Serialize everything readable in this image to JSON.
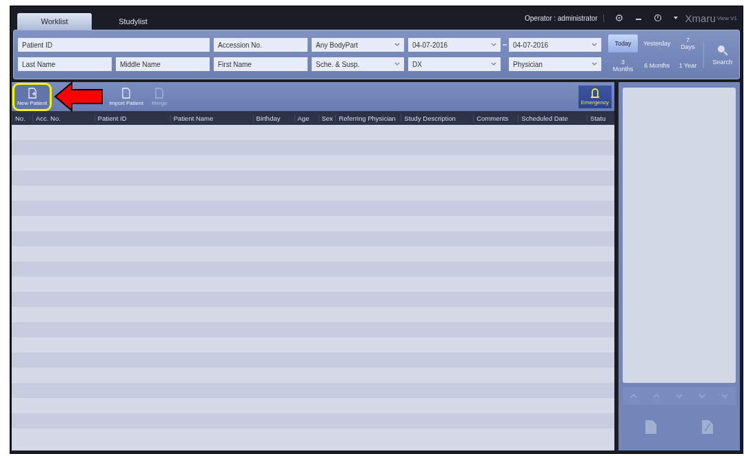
{
  "tabs": [
    {
      "label": "Worklist",
      "selected": true
    },
    {
      "label": "Studylist",
      "selected": false
    }
  ],
  "header": {
    "operator": "Operator : administrator",
    "logo": "Xmaru",
    "logo_suffix": "View V1"
  },
  "filters": {
    "row_1": [
      {
        "kind": "text",
        "placeholder": "Patient ID"
      },
      {
        "kind": "text",
        "placeholder": "Accession No."
      },
      {
        "kind": "select",
        "value": "Any BodyPart"
      },
      {
        "kind": "select",
        "value": "04-07-2016"
      },
      {
        "kind": "dash"
      },
      {
        "kind": "select",
        "value": "04-07-2016"
      }
    ],
    "row_2": [
      {
        "kind": "text",
        "placeholder": "Last Name"
      },
      {
        "kind": "text",
        "placeholder": "Middle Name"
      },
      {
        "kind": "text",
        "placeholder": "First Name"
      },
      {
        "kind": "select",
        "value": "Sche. & Susp."
      },
      {
        "kind": "select",
        "value": "DX"
      },
      {
        "kind": "select",
        "value": "Physician"
      }
    ],
    "ranges": [
      {
        "label": "Today",
        "selected": true
      },
      {
        "label": "Yesterday",
        "selected": false
      },
      {
        "label": "7 Days",
        "selected": false
      },
      {
        "label": "3 Months",
        "selected": false
      },
      {
        "label": "6 Months",
        "selected": false
      },
      {
        "label": "1 Year",
        "selected": false
      }
    ],
    "search_button": "Search"
  },
  "toolbar": [
    {
      "label": "New Patient",
      "disabled": false,
      "highlighted": true
    },
    {
      "label": "Import Patient",
      "disabled": false,
      "highlighted": false
    },
    {
      "label": "Merge",
      "disabled": true,
      "highlighted": false
    }
  ],
  "emergency_button": "Emergency",
  "table": {
    "columns": [
      "No.",
      "Acc. No.",
      "Patient ID",
      "Patient Name",
      "Birthday",
      "Age",
      "Sex",
      "Referring Physician",
      "Study Description",
      "Comments",
      "Scheduled Date",
      "Statu"
    ]
  }
}
